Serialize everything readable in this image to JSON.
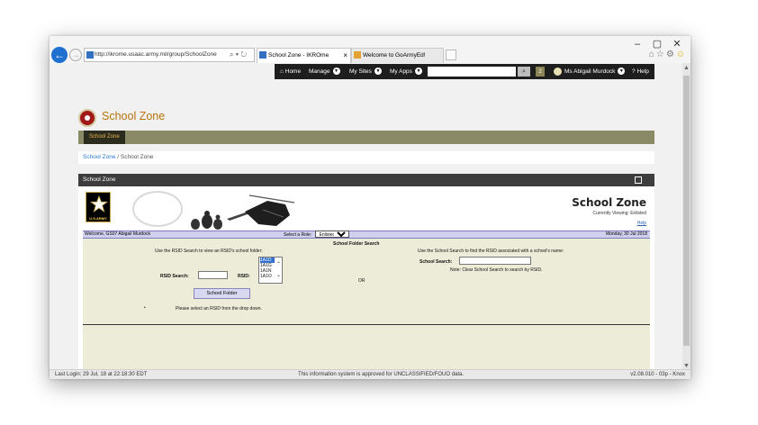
{
  "browser": {
    "url": "http://ikrome.usaac.army.mil/group/SchoolZone",
    "tabs": [
      {
        "label": "School Zone - IKROme",
        "active": true
      },
      {
        "label": "Welcome to GoArmyEd!",
        "active": false
      }
    ],
    "window_controls": [
      "–",
      "▢",
      "✕"
    ]
  },
  "topnav": {
    "home": "Home",
    "manage": "Manage",
    "my_sites": "My Sites",
    "my_apps": "My Apps",
    "notification_count": "2",
    "user": "Ms Abigail Murdock",
    "help": "Help"
  },
  "site": {
    "title": "School Zone",
    "subnav_tab": "School Zone"
  },
  "breadcrumb": {
    "root": "School Zone",
    "separator": " / ",
    "current": "School Zone"
  },
  "portlet": {
    "title": "School Zone"
  },
  "banner": {
    "army_text": "U.S.ARMY",
    "title": "School Zone",
    "viewing": "Currently Viewing: Enlisted",
    "help": "Help"
  },
  "welcome_bar": {
    "welcome": "Welcome, GS07 Abigail Murdock",
    "role_label": "Select a Role:",
    "role_value": "Enlisted",
    "date": "Monday, 30 Jul 2018"
  },
  "folder_search": {
    "title": "School Folder Search",
    "left_instructions": "Use the RSID Search to view an RSID's school folder:",
    "rsid_search_label": "RSID Search:",
    "rsid_label": "RSID:",
    "rsid_options": [
      "1A1D",
      "1A1G",
      "1A1N",
      "1A1O"
    ],
    "rsid_selected": "1A1D",
    "or_text": "OR",
    "right_instructions": "Use the School Search to find the RSID associated with a school's name:",
    "school_search_label": "School Search:",
    "note": "Note: Clear School Search to search by RSID.",
    "button": "School Folder",
    "bullet": "•",
    "message": "Please select an RSID from the drop down."
  },
  "status_bar": {
    "last_login": "Last Login: 29 Jul, 18 at 22:18:30 EDT",
    "notice": "This information system is approved for UNCLASSIFIED/FOUO data.",
    "version": "v2.08.010 - 03p - Knox"
  },
  "colors": {
    "accent_gold": "#b8720c",
    "subbar": "#8a8a67",
    "link": "#2a7ad0",
    "form_bg": "#ececd8"
  }
}
